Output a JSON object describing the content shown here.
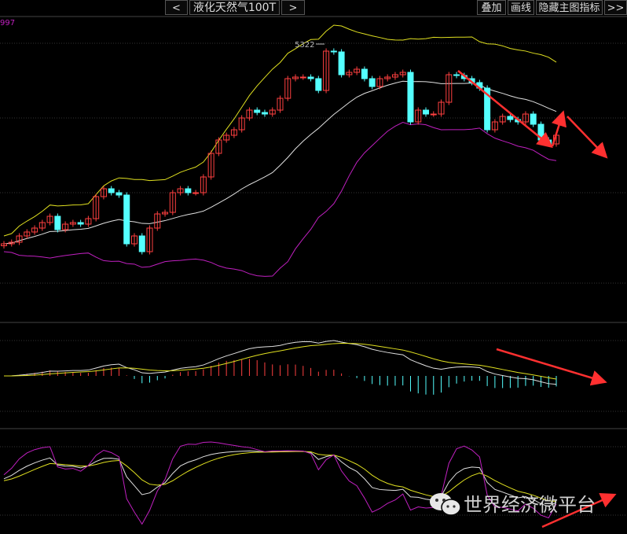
{
  "toolbar": {
    "prev_label": "<",
    "title": "液化天然气100T",
    "next_label": ">",
    "overlay_label": "叠加",
    "draw_label": "画线",
    "hide_indicator_label": "隐藏主图指标",
    "more_label": ">>"
  },
  "axis_label_top": "997",
  "watermark": "世界经济微平台",
  "colors": {
    "up": "#ff4040",
    "down": "#54ffff",
    "boll_upper": "#e0e020",
    "boll_mid": "#e0e0e0",
    "boll_lower": "#c020c0",
    "arrow": "#ff3030"
  },
  "chart_data": {
    "type": "candlestick",
    "title": "液化天然气100T",
    "peak_annotation": "5322",
    "note": "open = previous close",
    "close": [
      4300,
      4308,
      4340,
      4360,
      4380,
      4408,
      4440,
      4372,
      4400,
      4408,
      4400,
      4428,
      4540,
      4580,
      4560,
      4548,
      4300,
      4340,
      4260,
      4380,
      4452,
      4460,
      4560,
      4580,
      4560,
      4560,
      4640,
      4760,
      4828,
      4852,
      4880,
      4940,
      4980,
      4968,
      4960,
      4980,
      5040,
      5140,
      5148,
      5148,
      5140,
      5080,
      5280,
      5276,
      5160,
      5172,
      5188,
      5140,
      5100,
      5140,
      5148,
      5160,
      5172,
      4920,
      4980,
      4960,
      4960,
      5020,
      5160,
      5156,
      5140,
      5120,
      5092,
      4880,
      4920,
      4948,
      4932,
      4920,
      4960,
      4908,
      4828,
      4808,
      4852
    ],
    "ylim": [
      4000,
      5460
    ],
    "indicators": [
      "BOLL(20,2)",
      "MACD(12,26,9)",
      "KDJ(9,3,3)"
    ]
  }
}
